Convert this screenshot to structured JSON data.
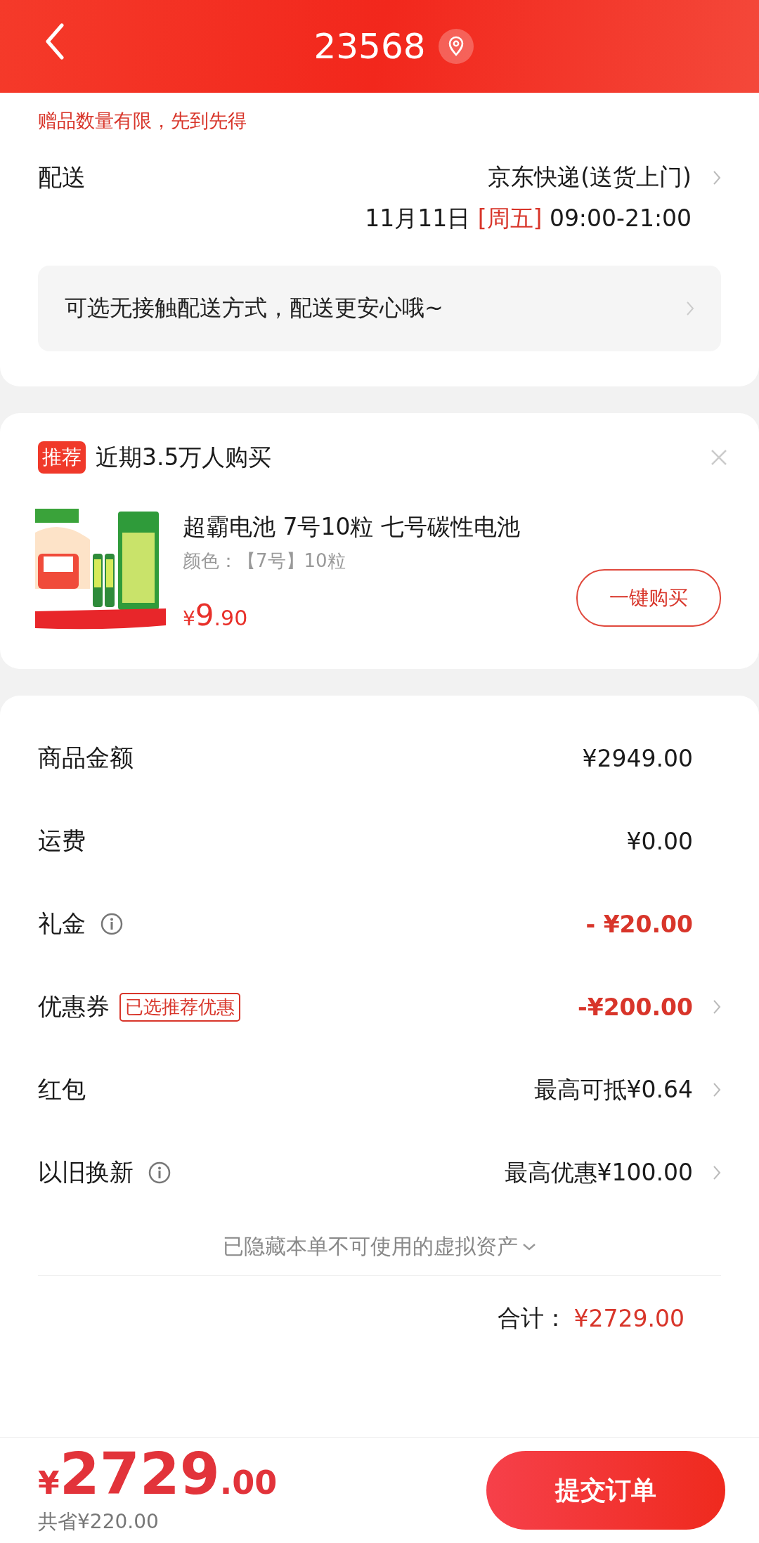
{
  "header": {
    "title": "23568"
  },
  "gift_note": "赠品数量有限，先到先得",
  "delivery": {
    "label": "配送",
    "carrier": "京东快递(送货上门)",
    "date": "11月11日",
    "weekday": "[周五]",
    "time": "09:00-21:00"
  },
  "contactless_notice": "可选无接触配送方式，配送更安心哦~",
  "recommendation": {
    "tag": "推荐",
    "headline": "近期3.5万人购买",
    "product": {
      "title": "超霸电池 7号10粒 七号碳性电池",
      "spec": "颜色：【7号】10粒",
      "price_symbol": "¥",
      "price_int": "9",
      "price_dec": ".90",
      "button": "一键购买"
    }
  },
  "summary": {
    "rows": [
      {
        "label": "商品金额",
        "info": false,
        "value": "¥2949.00",
        "discount": false,
        "chevron": false
      },
      {
        "label": "运费",
        "info": false,
        "value": "¥0.00",
        "discount": false,
        "chevron": false
      },
      {
        "label": "礼金",
        "info": true,
        "value": "- ¥20.00",
        "discount": true,
        "chevron": false
      },
      {
        "label": "优惠券",
        "info": false,
        "badge": "已选推荐优惠",
        "value": "-¥200.00",
        "discount": true,
        "chevron": true
      },
      {
        "label": "红包",
        "info": false,
        "value": "最高可抵¥0.64",
        "discount": false,
        "chevron": true
      },
      {
        "label": "以旧换新",
        "info": true,
        "value": "最高优惠¥100.00",
        "discount": false,
        "chevron": true
      }
    ],
    "hidden_assets": "已隐藏本单不可使用的虚拟资产",
    "total_label": "合计：",
    "total_value": "¥2729.00"
  },
  "footer": {
    "price_symbol": "¥",
    "price_int": "2729",
    "price_dec": ".00",
    "savings": "共省¥220.00",
    "submit": "提交订单"
  }
}
